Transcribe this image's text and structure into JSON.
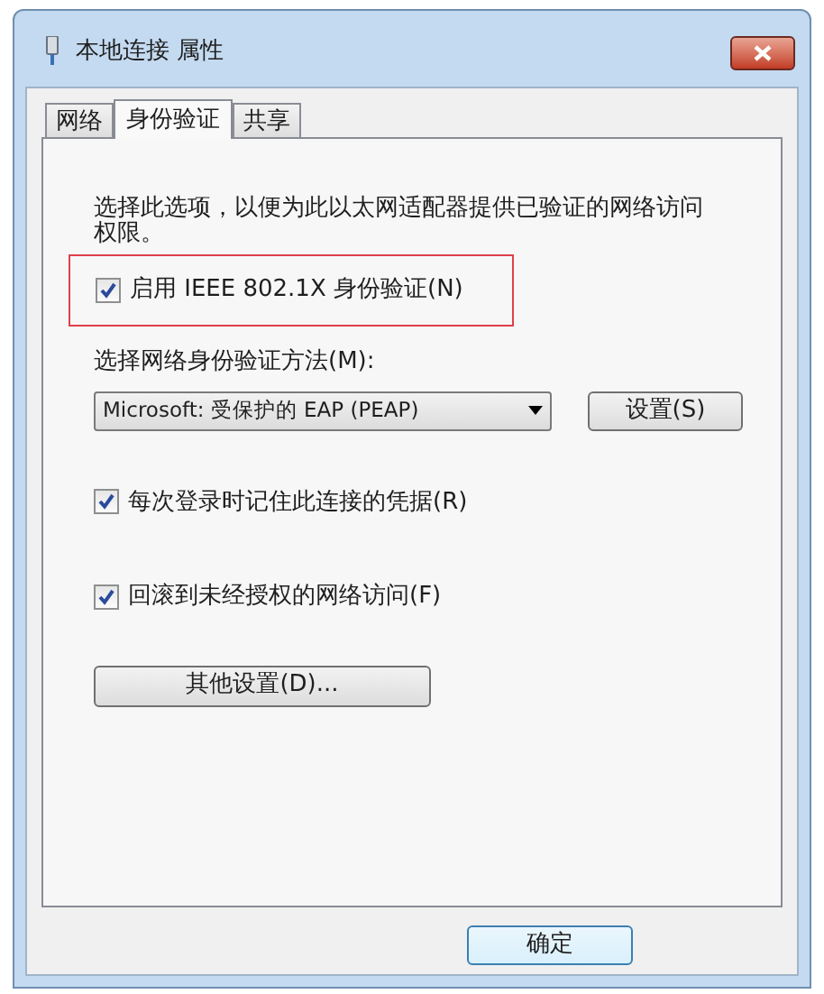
{
  "window": {
    "title": "本地连接 属性"
  },
  "tabs": [
    {
      "label": "网络",
      "selected": false
    },
    {
      "label": "身份验证",
      "selected": true
    },
    {
      "label": "共享",
      "selected": false
    }
  ],
  "description": "选择此选项，以便为此以太网适配器提供已验证的网络访问权限。",
  "enable_8021x": {
    "label": "启用 IEEE 802.1X 身份验证(N)",
    "checked": true,
    "highlighted": true
  },
  "method_label": "选择网络身份验证方法(M):",
  "method_select": {
    "value": "Microsoft: 受保护的 EAP (PEAP)"
  },
  "settings_button": "设置(S)",
  "options": [
    {
      "label": "每次登录时记住此连接的凭据(R)",
      "checked": true
    },
    {
      "label": "回滚到未经授权的网络访问(F)",
      "checked": true
    }
  ],
  "additional_settings_button": "其他设置(D)...",
  "ok_button": "确定"
}
